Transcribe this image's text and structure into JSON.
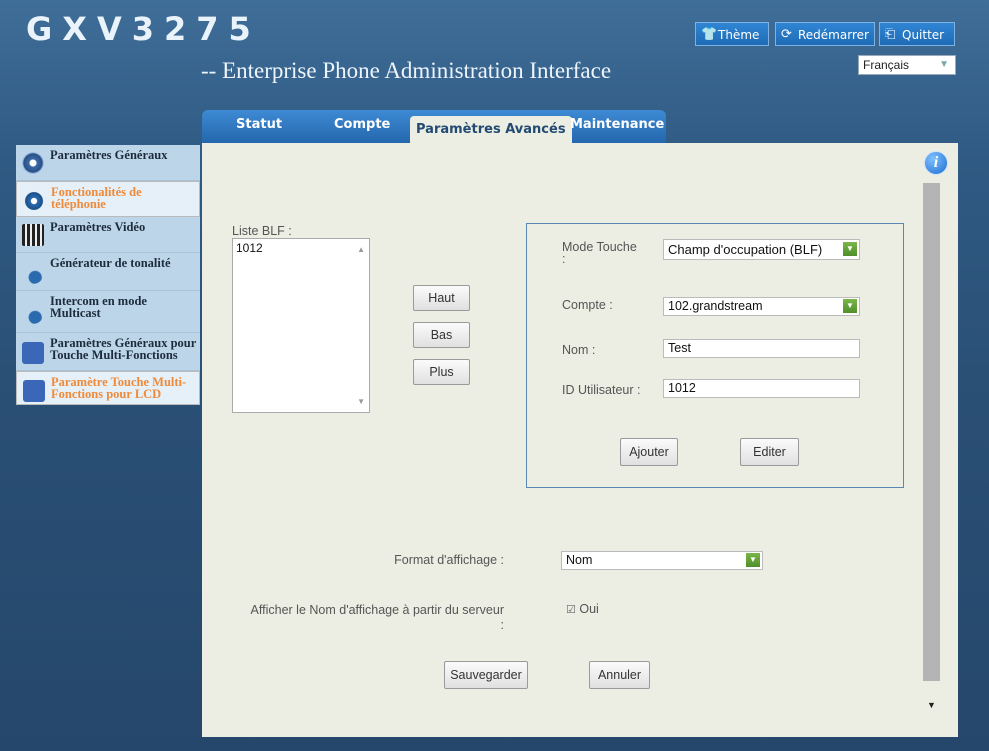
{
  "brand": "GXV3275",
  "subtitle": "-- Enterprise Phone Administration Interface",
  "top_buttons": {
    "theme": "Thème",
    "reboot": "Redémarrer",
    "quit": "Quitter"
  },
  "language": "Français",
  "tabs": [
    "Statut",
    "Compte",
    "Paramètres Avancés",
    "Maintenance"
  ],
  "sidebar": {
    "items": [
      {
        "label": "Paramètres Généraux",
        "icon": "gear-icon"
      },
      {
        "label": "Fonctionalités de téléphonie",
        "icon": "phone-icon"
      },
      {
        "label": "Paramètres Vidéo",
        "icon": "video-icon"
      },
      {
        "label": "Générateur de tonalité",
        "icon": "music-icon"
      },
      {
        "label": "Intercom en mode Multicast",
        "icon": "music-icon"
      },
      {
        "label": "Paramètres Généraux pour Touche Multi-Fonctions",
        "icon": "mpk-icon"
      },
      {
        "label": "Paramètre Touche Multi-Fonctions pour LCD",
        "icon": "mpk-icon"
      }
    ]
  },
  "blf": {
    "label": "Liste BLF :",
    "items": [
      "1012"
    ]
  },
  "move_buttons": {
    "up": "Haut",
    "down": "Bas",
    "more": "Plus"
  },
  "form": {
    "mode_label": "Mode Touche\n:",
    "mode_value": "Champ d'occupation (BLF)",
    "account_label": "Compte :",
    "account_value": "102.grandstream",
    "name_label": "Nom :",
    "name_value": "Test",
    "userid_label": "ID Utilisateur :",
    "userid_value": "1012",
    "add": "Ajouter",
    "edit": "Editer"
  },
  "display": {
    "format_label": "Format d'affichage :",
    "format_value": "Nom",
    "server_label": "Afficher le Nom d'affichage à partir du serveur :",
    "server_option": "Oui"
  },
  "actions": {
    "save": "Sauvegarder",
    "cancel": "Annuler"
  },
  "colors": {
    "accent": "#2f86d5",
    "selected_sidebar": "#ef8a3a",
    "dropdown": "#5ea136"
  }
}
